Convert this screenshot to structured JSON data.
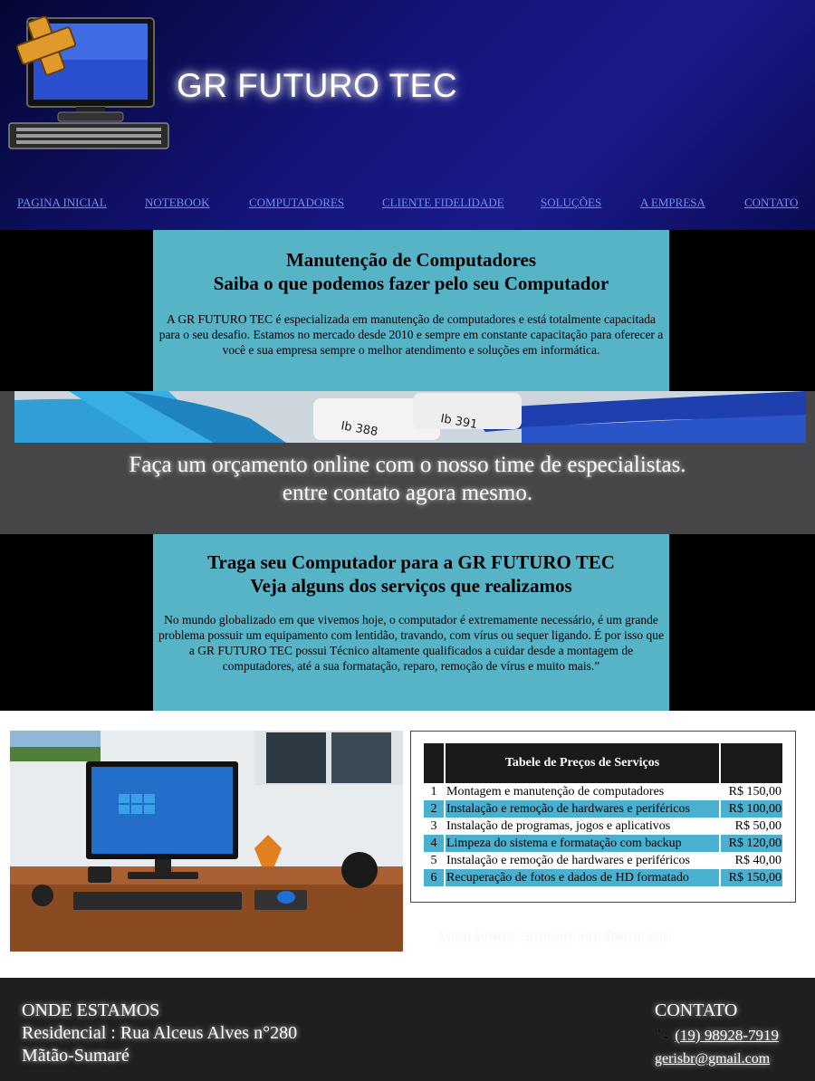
{
  "header": {
    "site_title": "GR FUTURO TEC",
    "logo_icon": "computer-with-plus-icon"
  },
  "nav": {
    "items": [
      {
        "label": "PAGINA INICIAL"
      },
      {
        "label": "NOTEBOOK"
      },
      {
        "label": "COMPUTADORES"
      },
      {
        "label": "CLIENTE FIDELIDADE"
      },
      {
        "label": "SOLUÇÕES"
      },
      {
        "label": "A EMPRESA"
      },
      {
        "label": "CONTATO"
      }
    ]
  },
  "section1": {
    "title_line1": "Manutenção de Computadores",
    "title_line2": "Saiba o que podemos fazer pelo seu Computador",
    "text": "A GR FUTURO TEC é especializada em manutenção de computadores e está totalmente capacitada para o seu desafio. Estamos no mercado desde 2010 e sempre em constante capacitação para oferecer a você e sua empresa sempre o melhor atendimento e soluções em informática."
  },
  "promo": {
    "line1": "Faça um orçamento online com o nosso time de especialistas.",
    "line2": "entre contato agora mesmo."
  },
  "section2": {
    "title_line1": "Traga seu Computador para a GR FUTURO TEC",
    "title_line2": "Veja alguns dos serviços que realizamos",
    "text": "No mundo globalizado em que vivemos hoje, o computador é extremamente necessário, é um grande problema possuir um equipamento com lentidão, travando, com vírus ou sequer ligando. É por isso que a GR FUTURO TEC possui Técnico altamente qualificados a cuidar desde a montagem de computadores, até a sua formatação, reparo, remoção de vírus e muito mais.”"
  },
  "price_table": {
    "header": "Tabele de Preços de Serviços",
    "rows": [
      {
        "n": "1",
        "service": "Montagem e manutenção de computadores",
        "price": "R$ 150,00"
      },
      {
        "n": "2",
        "service": "Instalação e remoção de hardwares e periféricos",
        "price": "R$ 100,00"
      },
      {
        "n": "3",
        "service": "Instalação de programas, jogos e aplicativos",
        "price": "R$ 50,00"
      },
      {
        "n": "4",
        "service": "Limpeza do sistema e formatação com backup",
        "price": "R$ 120,00"
      },
      {
        "n": "5",
        "service": "Instalação e remoção de hardwares e periféricos",
        "price": "R$ 40,00"
      },
      {
        "n": "6",
        "service": "Recuperação de fotos e dados de HD formatado",
        "price": "R$ 150,00"
      }
    ]
  },
  "domicilio": "Atendemos também em domicílio",
  "footer": {
    "location_title": "ONDE ESTAMOS",
    "address": "Residencial : Rua Alceus Alves n°280",
    "city": "Mãtão-Sumaré",
    "contact_title": "CONTATO",
    "phone_icon": "phone-icon",
    "phone": "(19) 98928-7919",
    "email": "gerisbr@gmail.com"
  },
  "colors": {
    "header_bg": "#14147a",
    "nav_link": "#6f8cf0",
    "panel_bg": "#57b3c6",
    "table_alt_row": "#4ab0d0",
    "footer_bg": "#211e1e"
  }
}
